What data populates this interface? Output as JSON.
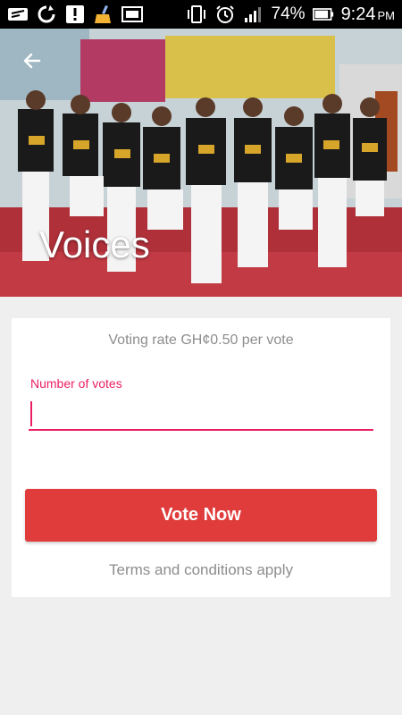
{
  "status_bar": {
    "battery_percent": "74%",
    "time": "9:24",
    "ampm": "PM",
    "icons": [
      "messages-icon",
      "sync-icon",
      "alert-icon",
      "cleaner-icon",
      "gallery-icon",
      "vibrate-icon",
      "alarm-icon",
      "signal-icon",
      "battery-icon"
    ]
  },
  "hero": {
    "title": "Voices"
  },
  "voting": {
    "rate_text": "Voting rate GH¢0.50 per vote",
    "votes_label": "Number of votes",
    "votes_value": "",
    "vote_button_label": "Vote Now",
    "terms_text": "Terms and conditions apply"
  },
  "colors": {
    "accent": "#e91e63",
    "button": "#e03c3c",
    "muted_text": "#8d8d8d",
    "background": "#efefef"
  }
}
